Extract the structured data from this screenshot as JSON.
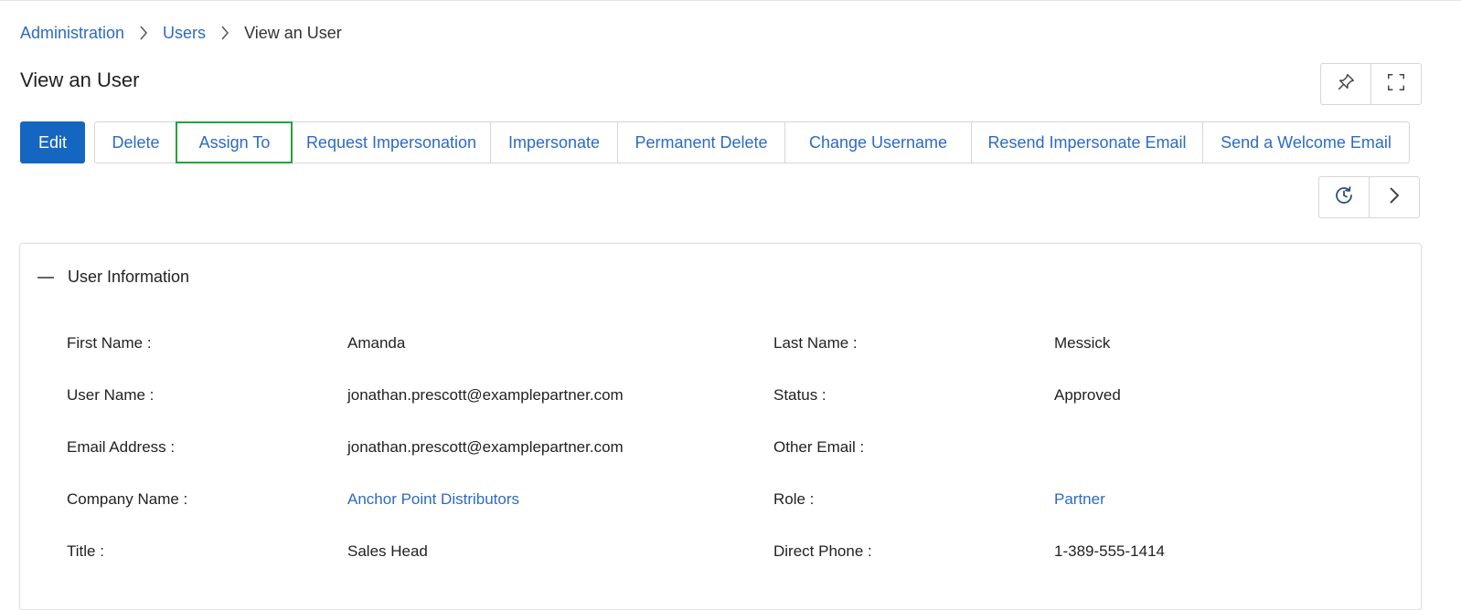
{
  "breadcrumb": {
    "items": [
      "Administration",
      "Users"
    ],
    "current": "View an User"
  },
  "page": {
    "title": "View an User"
  },
  "header_icons": [
    "pin-icon",
    "fullscreen-icon"
  ],
  "toolbar": {
    "edit_label": "Edit",
    "buttons": [
      "Delete",
      "Assign To",
      "Request Impersonation",
      "Impersonate",
      "Permanent Delete",
      "Change Username",
      "Resend Impersonate Email",
      "Send a Welcome Email"
    ],
    "highlighted": "Assign To"
  },
  "secondary_icons": [
    "history-icon",
    "chevron-right-icon"
  ],
  "user_info": {
    "section_title": "User Information",
    "fields": {
      "first_name": {
        "label": "First Name :",
        "value": "Amanda"
      },
      "last_name": {
        "label": "Last Name :",
        "value": "Messick"
      },
      "user_name": {
        "label": "User Name :",
        "value": "jonathan.prescott@examplepartner.com"
      },
      "status": {
        "label": "Status :",
        "value": "Approved"
      },
      "email": {
        "label": "Email Address :",
        "value": "jonathan.prescott@examplepartner.com"
      },
      "other_email": {
        "label": "Other Email :",
        "value": ""
      },
      "company": {
        "label": "Company Name :",
        "value": "Anchor Point Distributors"
      },
      "role": {
        "label": "Role :",
        "value": "Partner"
      },
      "title": {
        "label": "Title :",
        "value": "Sales Head"
      },
      "direct_phone": {
        "label": "Direct Phone :",
        "value": "1-389-555-1414"
      }
    }
  },
  "colors": {
    "primary": "#1566c0",
    "link": "#2d6ac4",
    "highlight": "#23a33a"
  }
}
